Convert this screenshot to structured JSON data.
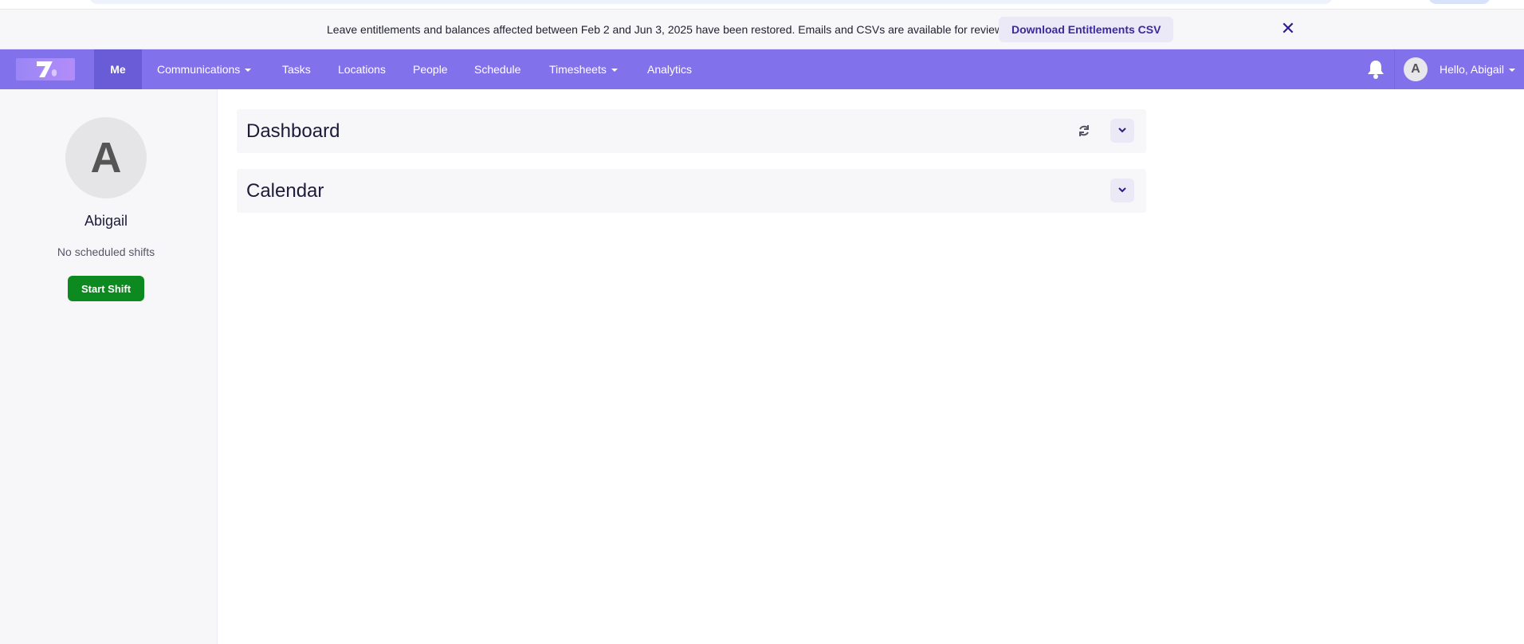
{
  "banner": {
    "message": "Leave entitlements and balances affected between Feb 2 and Jun 3, 2025 have been restored. Emails and CSVs are available for review.",
    "download_label": "Download Entitlements CSV",
    "close_glyph": "✕"
  },
  "nav": {
    "me": "Me",
    "communications": "Communications",
    "tasks": "Tasks",
    "locations": "Locations",
    "people": "People",
    "schedule": "Schedule",
    "timesheets": "Timesheets",
    "analytics": "Analytics",
    "avatar_initial": "A",
    "greeting": "Hello, Abigail"
  },
  "profile": {
    "initial": "A",
    "name": "Abigail",
    "shifts": "No scheduled shifts",
    "start_shift": "Start Shift"
  },
  "panels": {
    "dashboard": "Dashboard",
    "calendar": "Calendar"
  },
  "colors": {
    "nav_bg": "#8172ec",
    "nav_active": "#6a5bd6",
    "start_shift": "#0d8a1f",
    "banner_link": "#3a2a9c"
  },
  "icons": [
    "bell-icon",
    "refresh-icon",
    "chevron-down-icon",
    "close-icon",
    "caret-down-icon",
    "logo"
  ]
}
